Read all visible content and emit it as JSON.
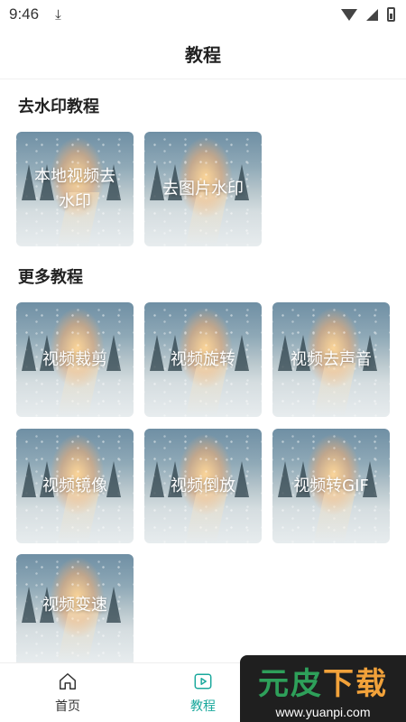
{
  "status_bar": {
    "time": "9:46",
    "download_glyph": "⤓"
  },
  "header": {
    "title": "教程"
  },
  "sections": [
    {
      "title": "去水印教程",
      "items": [
        "本地视频去水印",
        "去图片水印"
      ]
    },
    {
      "title": "更多教程",
      "items": [
        "视频裁剪",
        "视频旋转",
        "视频去声音",
        "视频镜像",
        "视频倒放",
        "视频转GIF",
        "视频变速"
      ]
    }
  ],
  "bottom_nav": {
    "items": [
      {
        "label": "首页",
        "icon": "home-icon",
        "active": false
      },
      {
        "label": "教程",
        "icon": "play-icon",
        "active": true
      }
    ],
    "active_color": "#19a89c",
    "inactive_color": "#333333"
  },
  "watermark": {
    "main_green": "元皮",
    "main_orange": "下载",
    "sub": "www.yuanpi.com"
  }
}
